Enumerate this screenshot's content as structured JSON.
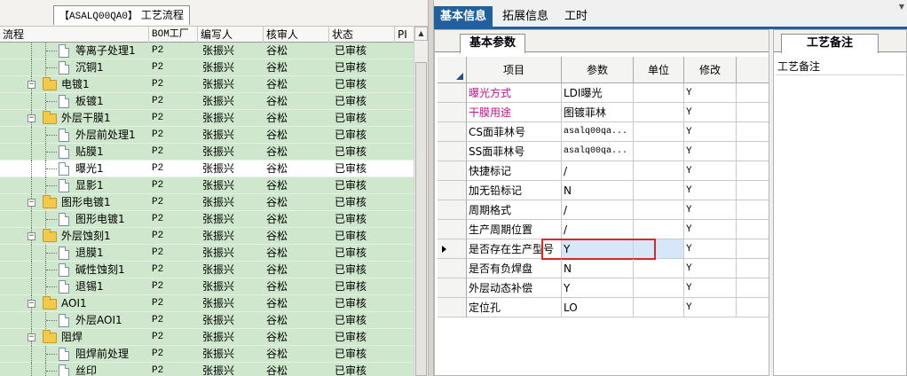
{
  "left_panel": {
    "tab_code": "【ASALQ00QA0】",
    "tab_title": "工艺流程",
    "columns": [
      "流程",
      "BOM工厂",
      "编写人",
      "核审人",
      "状态",
      "PI"
    ],
    "rows": [
      {
        "label": "等离子处理1",
        "level": 1,
        "type": "doc",
        "bom": "P2",
        "writer": "张振兴",
        "reviewer": "谷松",
        "status": "已审核"
      },
      {
        "label": "沉铜1",
        "level": 1,
        "type": "doc",
        "bom": "P2",
        "writer": "张振兴",
        "reviewer": "谷松",
        "status": "已审核"
      },
      {
        "label": "电镀1",
        "level": 0,
        "type": "folder",
        "bom": "P2",
        "writer": "张振兴",
        "reviewer": "谷松",
        "status": "已审核"
      },
      {
        "label": "板镀1",
        "level": 1,
        "type": "doc",
        "bom": "P2",
        "writer": "张振兴",
        "reviewer": "谷松",
        "status": "已审核"
      },
      {
        "label": "外层干膜1",
        "level": 0,
        "type": "folder",
        "bom": "P2",
        "writer": "张振兴",
        "reviewer": "谷松",
        "status": "已审核"
      },
      {
        "label": "外层前处理1",
        "level": 1,
        "type": "doc",
        "bom": "P2",
        "writer": "张振兴",
        "reviewer": "谷松",
        "status": "已审核"
      },
      {
        "label": "贴膜1",
        "level": 1,
        "type": "doc",
        "bom": "P2",
        "writer": "张振兴",
        "reviewer": "谷松",
        "status": "已审核"
      },
      {
        "label": "曝光1",
        "level": 1,
        "type": "doc",
        "bom": "P2",
        "writer": "张振兴",
        "reviewer": "谷松",
        "status": "已审核",
        "selected": true
      },
      {
        "label": "显影1",
        "level": 1,
        "type": "doc",
        "bom": "P2",
        "writer": "张振兴",
        "reviewer": "谷松",
        "status": "已审核"
      },
      {
        "label": "图形电镀1",
        "level": 0,
        "type": "folder",
        "bom": "P2",
        "writer": "张振兴",
        "reviewer": "谷松",
        "status": "已审核"
      },
      {
        "label": "图形电镀1",
        "level": 1,
        "type": "doc",
        "bom": "P2",
        "writer": "张振兴",
        "reviewer": "谷松",
        "status": "已审核"
      },
      {
        "label": "外层蚀刻1",
        "level": 0,
        "type": "folder",
        "bom": "P2",
        "writer": "张振兴",
        "reviewer": "谷松",
        "status": "已审核"
      },
      {
        "label": "退膜1",
        "level": 1,
        "type": "doc",
        "bom": "P2",
        "writer": "张振兴",
        "reviewer": "谷松",
        "status": "已审核"
      },
      {
        "label": "碱性蚀刻1",
        "level": 1,
        "type": "doc",
        "bom": "P2",
        "writer": "张振兴",
        "reviewer": "谷松",
        "status": "已审核"
      },
      {
        "label": "退锡1",
        "level": 1,
        "type": "doc",
        "bom": "P2",
        "writer": "张振兴",
        "reviewer": "谷松",
        "status": "已审核"
      },
      {
        "label": "AOI1",
        "level": 0,
        "type": "folder",
        "bom": "P2",
        "writer": "张振兴",
        "reviewer": "谷松",
        "status": "已审核"
      },
      {
        "label": "外层AOI1",
        "level": 1,
        "type": "doc",
        "bom": "P2",
        "writer": "张振兴",
        "reviewer": "谷松",
        "status": "已审核"
      },
      {
        "label": "阻焊",
        "level": 0,
        "type": "folder",
        "bom": "P2",
        "writer": "张振兴",
        "reviewer": "谷松",
        "status": "已审核"
      },
      {
        "label": "阻焊前处理",
        "level": 1,
        "type": "doc",
        "bom": "P2",
        "writer": "张振兴",
        "reviewer": "谷松",
        "status": "已审核"
      },
      {
        "label": "丝印",
        "level": 1,
        "type": "doc",
        "bom": "P2",
        "writer": "张振兴",
        "reviewer": "谷松",
        "status": "已审核"
      }
    ]
  },
  "right_tabs": {
    "items": [
      "基本信息",
      "拓展信息",
      "工时"
    ],
    "active": 0
  },
  "params": {
    "subtab": "基本参数",
    "headers": [
      "项目",
      "参数",
      "单位",
      "修改"
    ],
    "rows": [
      {
        "name": "曝光方式",
        "value": "LDI曝光",
        "unit": "",
        "modify": "Y",
        "highlight": true
      },
      {
        "name": "干膜用途",
        "value": "图镀菲林",
        "unit": "",
        "modify": "Y",
        "highlight": true
      },
      {
        "name": "CS面菲林号",
        "value": "asalq00qa...",
        "unit": "",
        "modify": "Y",
        "mono": true
      },
      {
        "name": "SS面菲林号",
        "value": "asalq00qa...",
        "unit": "",
        "modify": "Y",
        "mono": true
      },
      {
        "name": "快捷标记",
        "value": "/",
        "unit": "",
        "modify": "Y"
      },
      {
        "name": "加无铅标记",
        "value": "N",
        "unit": "",
        "modify": "Y"
      },
      {
        "name": "周期格式",
        "value": "/",
        "unit": "",
        "modify": "Y"
      },
      {
        "name": "生产周期位置",
        "value": "/",
        "unit": "",
        "modify": "Y"
      },
      {
        "name": "是否存在生产型号",
        "value": "Y",
        "unit": "",
        "modify": "Y",
        "current": true
      },
      {
        "name": "是否有负焊盘",
        "value": "N",
        "unit": "",
        "modify": "Y"
      },
      {
        "name": "外层动态补偿",
        "value": "Y",
        "unit": "",
        "modify": "Y"
      },
      {
        "name": "定位孔",
        "value": "LO",
        "unit": "",
        "modify": "Y"
      }
    ]
  },
  "remarks": {
    "tab": "工艺备注",
    "label": "工艺备注"
  }
}
